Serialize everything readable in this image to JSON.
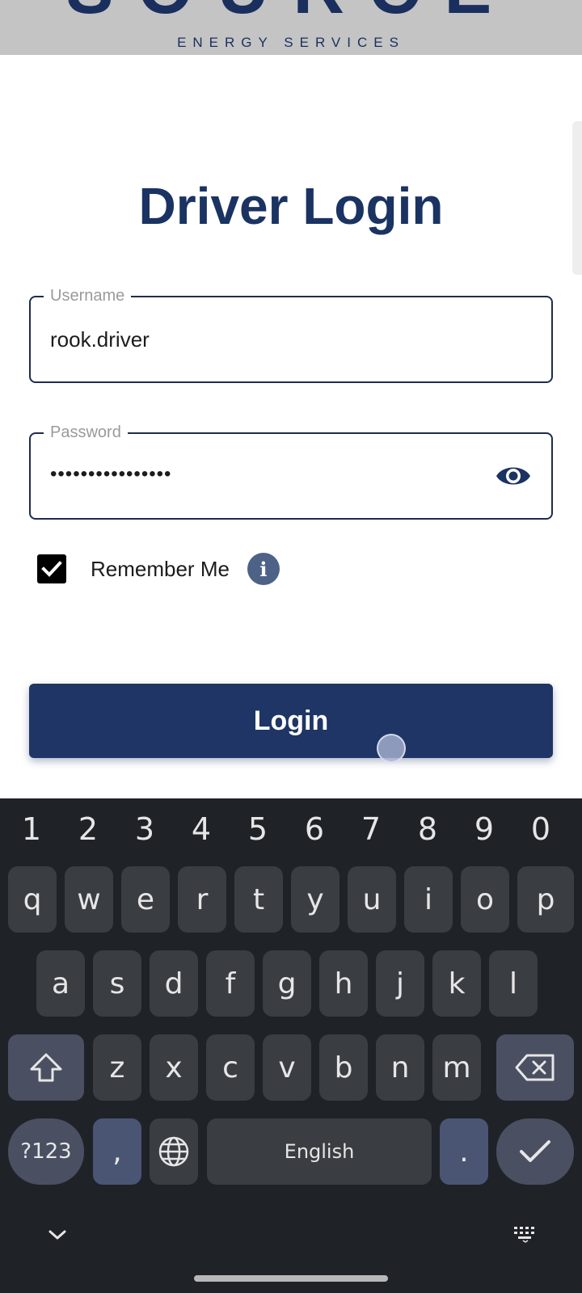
{
  "header": {
    "logo_text": "SOURCE",
    "logo_subtext": "ENERGY SERVICES"
  },
  "title": "Driver Login",
  "username": {
    "label": "Username",
    "value": "rook.driver"
  },
  "password": {
    "label": "Password",
    "masked_value": "••••••••••••••••"
  },
  "remember_me": {
    "label": "Remember Me",
    "checked": true
  },
  "info_icon_glyph": "i",
  "login_button": "Login",
  "keyboard": {
    "digits": [
      "1",
      "2",
      "3",
      "4",
      "5",
      "6",
      "7",
      "8",
      "9",
      "0"
    ],
    "row1": [
      "q",
      "w",
      "e",
      "r",
      "t",
      "y",
      "u",
      "i",
      "o",
      "p"
    ],
    "row2": [
      "a",
      "s",
      "d",
      "f",
      "g",
      "h",
      "j",
      "k",
      "l"
    ],
    "row3": [
      "z",
      "x",
      "c",
      "v",
      "b",
      "n",
      "m"
    ],
    "symbols_key": "?123",
    "comma_key": ",",
    "space_label": "English",
    "period_key": "."
  },
  "colors": {
    "brand_navy": "#1a3362",
    "button": "#1e3565",
    "keyboard_bg": "#1f2227"
  },
  "icons": [
    "eye-icon",
    "checkmark-icon",
    "info-icon",
    "shift-icon",
    "backspace-icon",
    "globe-icon",
    "enter-check-icon",
    "chevron-down-icon",
    "keyboard-icon"
  ]
}
